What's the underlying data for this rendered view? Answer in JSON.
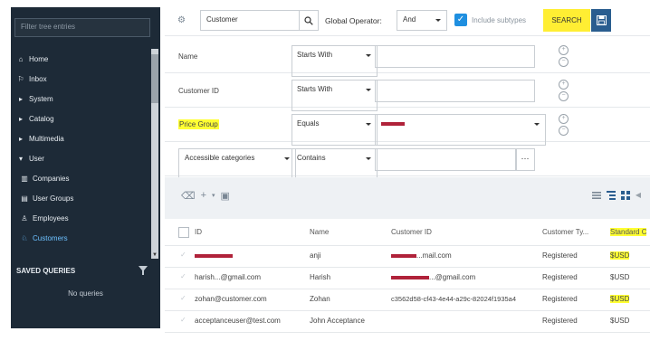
{
  "sidebar": {
    "filter_placeholder": "Filter tree entries",
    "tree": [
      {
        "label": "Home",
        "icon": "home-icon",
        "indent": false
      },
      {
        "label": "Inbox",
        "icon": "inbox-icon",
        "indent": false
      },
      {
        "label": "System",
        "icon": "triangle-right-icon",
        "indent": false
      },
      {
        "label": "Catalog",
        "icon": "triangle-right-icon",
        "indent": false
      },
      {
        "label": "Multimedia",
        "icon": "triangle-right-icon",
        "indent": false
      },
      {
        "label": "User",
        "icon": "triangle-down-icon",
        "indent": false
      },
      {
        "label": "Companies",
        "icon": "building-icon",
        "indent": true
      },
      {
        "label": "User Groups",
        "icon": "users-icon",
        "indent": true
      },
      {
        "label": "Employees",
        "icon": "employee-icon",
        "indent": true
      },
      {
        "label": "Customers",
        "icon": "customer-icon",
        "indent": true,
        "active": true
      }
    ],
    "saved_queries_title": "SAVED QUERIES",
    "no_queries": "No queries"
  },
  "search": {
    "type_value": "Customer",
    "global_operator_label": "Global Operator:",
    "global_operator_value": "And",
    "include_subtypes_label": "Include subtypes",
    "include_subtypes_checked": true,
    "search_button": "SEARCH"
  },
  "criteria": [
    {
      "field": "Name",
      "operator": "Starts With",
      "value": ""
    },
    {
      "field": "Customer ID",
      "operator": "Starts With",
      "value": ""
    },
    {
      "field": "Price Group",
      "operator": "Equals",
      "value": "(redacted)",
      "highlighted": true
    },
    {
      "field": "Accessible categories",
      "operator": "Contains",
      "value": ""
    }
  ],
  "table": {
    "columns": [
      "ID",
      "Name",
      "Customer ID",
      "Customer Ty...",
      "Standard C"
    ],
    "rows": [
      {
        "id": "anji@...com",
        "name": "anji",
        "customer_id": "...mail.com",
        "type": "Registered",
        "currency": "$USD",
        "highlight_currency": true
      },
      {
        "id": "harish...@gmail.com",
        "name": "Harish",
        "customer_id": "...@gmail.com",
        "type": "Registered",
        "currency": "$USD",
        "highlight_currency": false
      },
      {
        "id": "zohan@customer.com",
        "name": "Zohan",
        "customer_id": "c3562d58-cf43-4e44-a29c-82024f1935a4",
        "type": "Registered",
        "currency": "$USD",
        "highlight_currency": true
      },
      {
        "id": "acceptanceuser@test.com",
        "name": "John Acceptance",
        "customer_id": "",
        "type": "Registered",
        "currency": "$USD",
        "highlight_currency": false
      }
    ]
  },
  "colors": {
    "sidebar_bg": "#1d2a37",
    "highlight": "#ffff33",
    "accent": "#1f8fe0",
    "save_button": "#2a5d8f"
  }
}
